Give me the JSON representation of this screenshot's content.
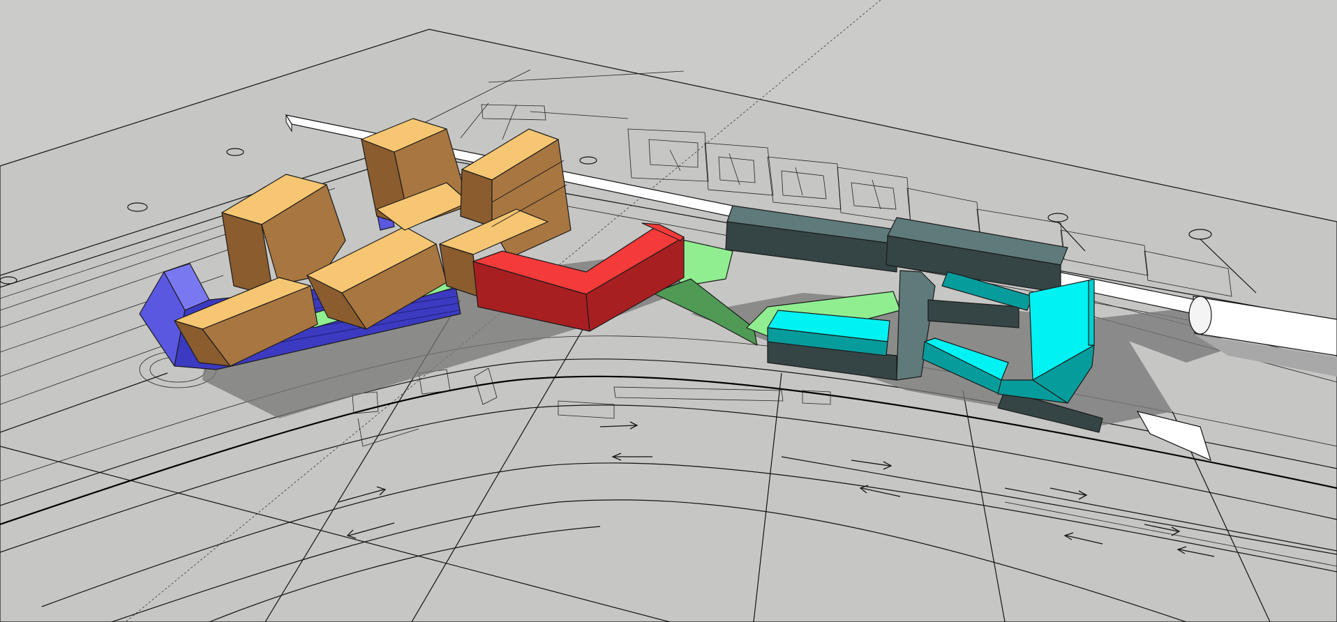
{
  "scene": {
    "kind": "3d-massing-model",
    "colors": {
      "background": "#cbcbc9",
      "ground_plane": "#c6c6c4",
      "linework": "#111111",
      "shadow": "#777777",
      "massing_orange_top": "#f6c672",
      "massing_orange_side": "#a87640",
      "massing_orange_front": "#8a5c2e",
      "massing_blue_light": "#7a78f0",
      "massing_blue_dark": "#3c3ac0",
      "massing_red_top": "#f53a3a",
      "massing_red_side": "#a81f22",
      "massing_green": "#90ee90",
      "massing_green_dark": "#4f9a55",
      "massing_slate_top": "#5f7a7a",
      "massing_slate_side": "#354545",
      "massing_cyan_top": "#00f2f2",
      "massing_cyan_side": "#079c9c",
      "massing_white": "#ffffff"
    },
    "masses": [
      {
        "name": "blue-podium",
        "color": "blue"
      },
      {
        "name": "orange-tower-west",
        "color": "orange"
      },
      {
        "name": "orange-tower-middle",
        "color": "orange"
      },
      {
        "name": "orange-tower-east",
        "color": "orange"
      },
      {
        "name": "red-l-block",
        "color": "red"
      },
      {
        "name": "green-bridge",
        "color": "green"
      },
      {
        "name": "slate-bar-north",
        "color": "slate"
      },
      {
        "name": "cyan-block",
        "color": "cyan"
      },
      {
        "name": "white-tube",
        "color": "white"
      }
    ],
    "icons": [
      "traffic-arrow-icon",
      "survey-marker-icon"
    ]
  }
}
